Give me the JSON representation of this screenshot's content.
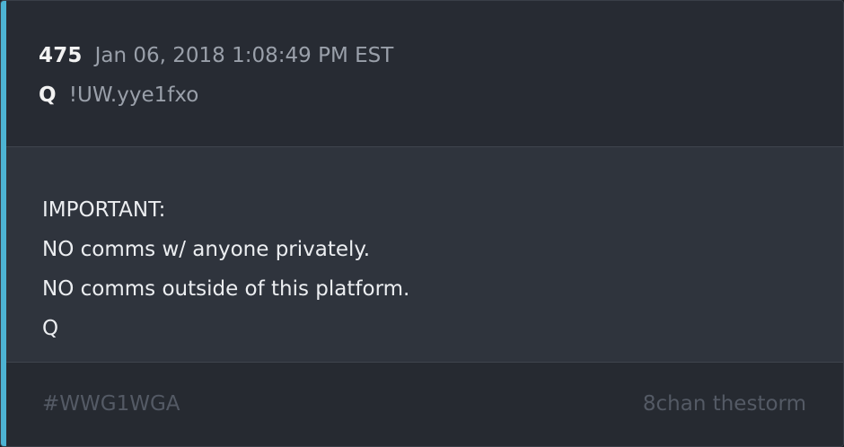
{
  "post": {
    "number": "475",
    "timestamp": "Jan 06, 2018 1:08:49 PM EST",
    "author": "Q",
    "tripcode": "!UW.yye1fxo",
    "message_lines": [
      "IMPORTANT:",
      "NO comms w/ anyone privately.",
      "NO comms outside of this platform.",
      "Q"
    ]
  },
  "footer": {
    "hashtag": "#WWG1WGA",
    "source": "8chan thestorm"
  },
  "colors": {
    "accent": "#4db3d3",
    "card_background": "#272b33",
    "body_background": "#2f343d",
    "primary_text": "#f2f2f2",
    "muted_text": "#9aa0aa",
    "footer_text": "#545a65"
  }
}
